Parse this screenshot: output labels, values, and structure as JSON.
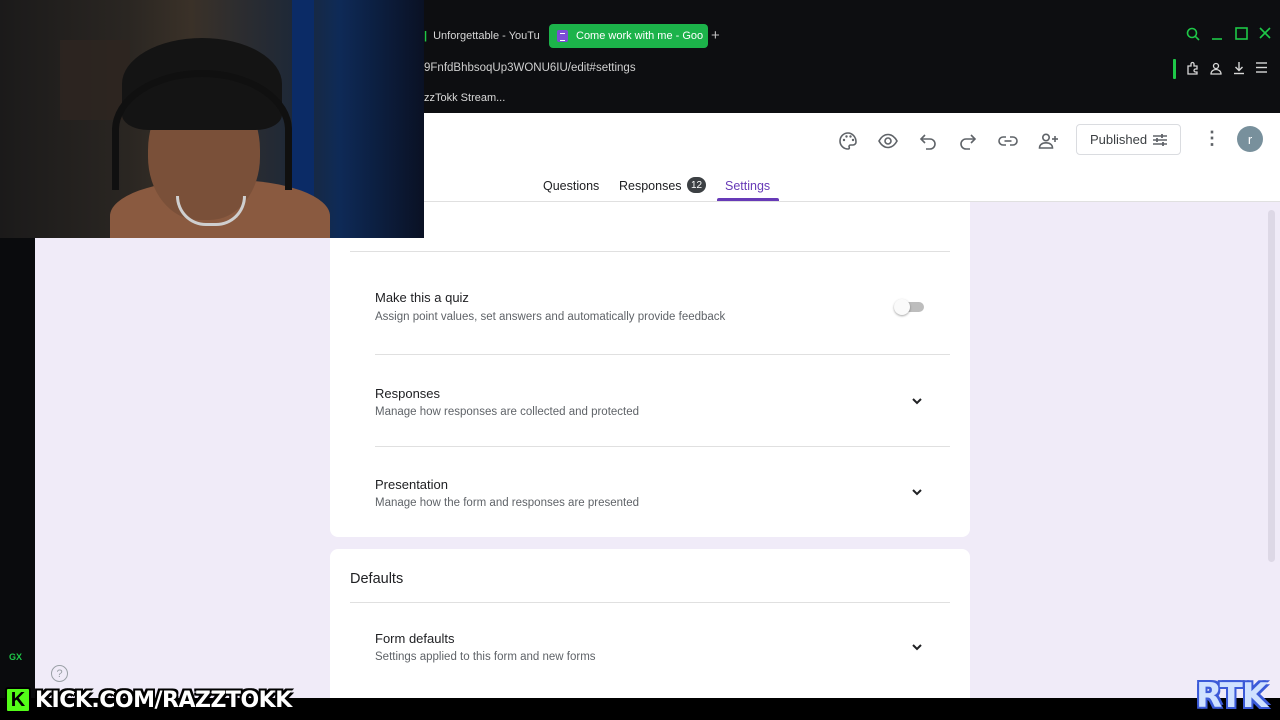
{
  "browser": {
    "tabs": [
      {
        "label": "Unforgettable - YouTu",
        "active": false
      },
      {
        "label": "Come work with me - Goo",
        "active": true
      }
    ],
    "url": "9FnfdBhbsoqUp3WONU6IU/edit#settings",
    "bookmark": "zzTokk Stream...",
    "gx_label": "GX",
    "accent_color": "#1ec848"
  },
  "form_header": {
    "toolbar_icons": [
      "palette-icon",
      "preview-eye-icon",
      "undo-icon",
      "redo-icon",
      "link-icon",
      "add-collaborator-icon"
    ],
    "published_label": "Published",
    "avatar_initial": "r",
    "tabs": {
      "questions": "Questions",
      "responses": "Responses",
      "responses_count": "12",
      "settings": "Settings"
    },
    "accent_color": "#673ab7"
  },
  "settings": {
    "quiz": {
      "title": "Make this a quiz",
      "description": "Assign point values, set answers and automatically provide feedback",
      "enabled": false
    },
    "responses": {
      "title": "Responses",
      "description": "Manage how responses are collected and protected"
    },
    "presentation": {
      "title": "Presentation",
      "description": "Manage how the form and responses are presented"
    }
  },
  "defaults": {
    "heading": "Defaults",
    "form_defaults": {
      "title": "Form defaults",
      "description": "Settings applied to this form and new forms"
    }
  },
  "help_icon_label": "?",
  "overlays": {
    "kick_logo_letter": "K",
    "kick_text": "KICK.COM/RAZZTOKK",
    "brand_tag": "RTK"
  }
}
